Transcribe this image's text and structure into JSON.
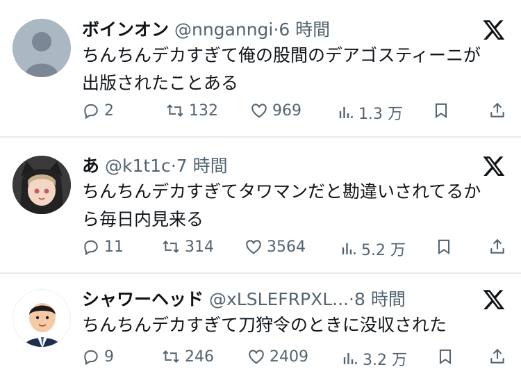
{
  "tweets": [
    {
      "name": "ボインオン",
      "handle": "@nnganngi",
      "dot": "·",
      "time": "6 時間",
      "lines": [
        "ちんちんデカすぎて俺の股間のデアゴスティーニが",
        "出版されたことある"
      ],
      "replies": "2",
      "retweets": "132",
      "likes": "969",
      "views": "1.3 万"
    },
    {
      "name": "あ",
      "handle": "@k1t1c",
      "dot": "·",
      "time": "7 時間",
      "lines": [
        "ちんちんデカすぎてタワマンだと勘違いされてるか",
        "ら毎日内見来る"
      ],
      "replies": "11",
      "retweets": "314",
      "likes": "3564",
      "views": "5.2 万"
    },
    {
      "name": "シャワーヘッド",
      "handle": "@xLSLEFRPXL...",
      "dot": "·",
      "time": "8 時間",
      "lines": [
        "ちんちんデカすぎて刀狩令のときに没収された"
      ],
      "replies": "9",
      "retweets": "246",
      "likes": "2409",
      "views": "3.2 万"
    }
  ],
  "colors": {
    "text": "#0f1419",
    "muted": "#536471",
    "divider": "#e8ebee"
  },
  "icons": [
    "reply-icon",
    "retweet-icon",
    "like-icon",
    "views-icon",
    "bookmark-icon",
    "share-icon",
    "x-logo-icon"
  ]
}
